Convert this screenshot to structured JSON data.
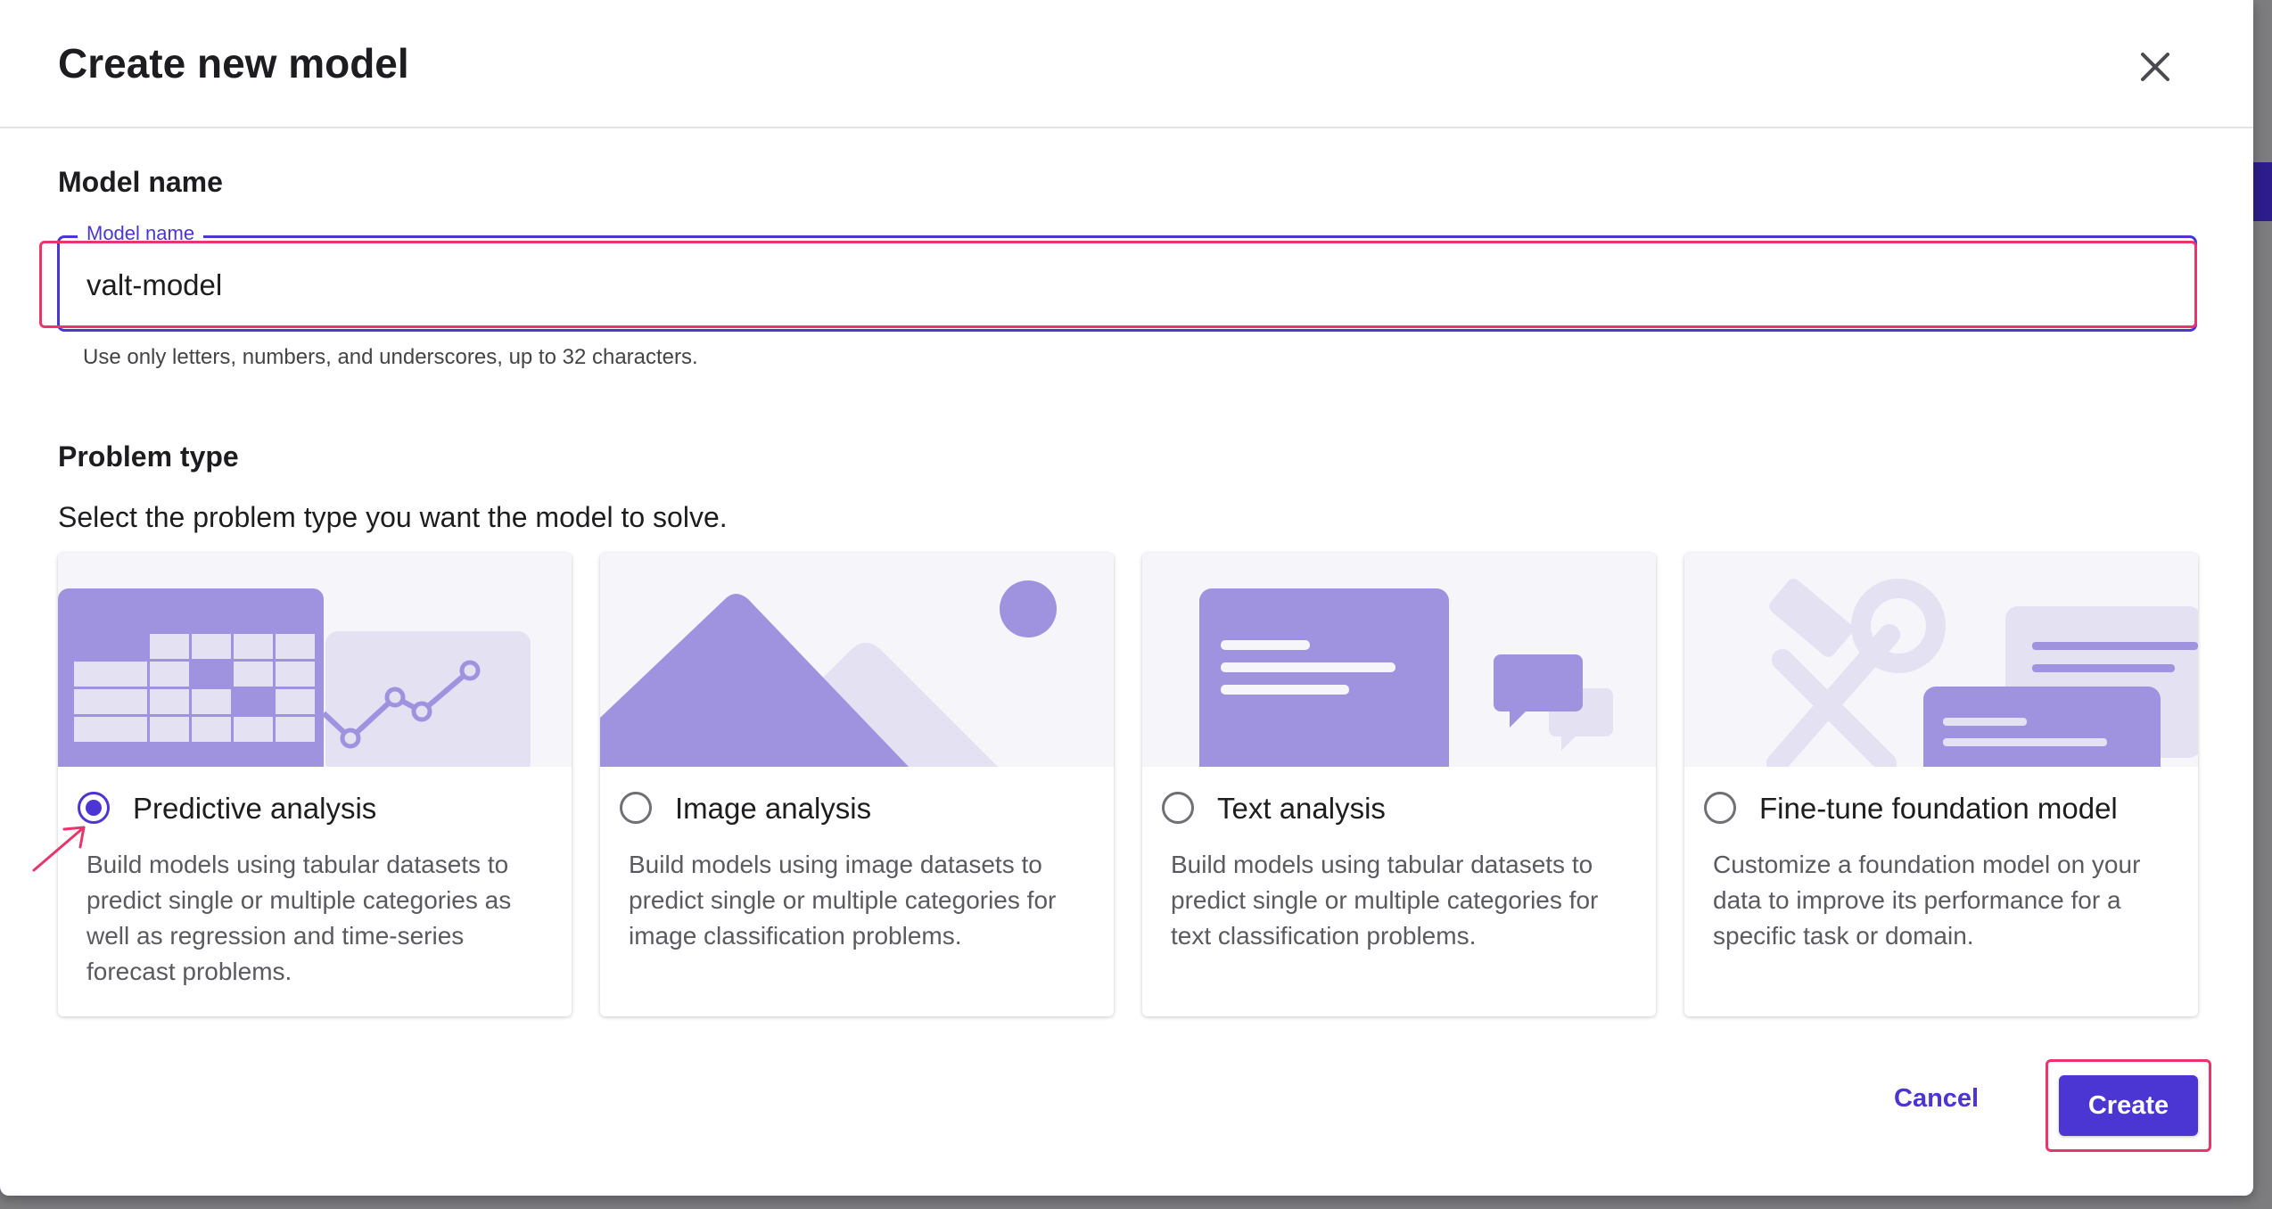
{
  "modal": {
    "title": "Create new model"
  },
  "model_name": {
    "section_title": "Model name",
    "legend": "Model name",
    "value": "valt-model",
    "helper": "Use only letters, numbers, and underscores, up to 32 characters."
  },
  "problem_type": {
    "section_title": "Problem type",
    "subtitle": "Select the problem type you want the model to solve.",
    "cards": [
      {
        "label": "Predictive analysis",
        "description": "Build models using tabular datasets to predict single or multiple categories as well as regression and time-series forecast problems.",
        "selected": true
      },
      {
        "label": "Image analysis",
        "description": "Build models using image datasets to predict single or multiple categories for image classification problems.",
        "selected": false
      },
      {
        "label": "Text analysis",
        "description": "Build models using tabular datasets to predict single or multiple categories for text classification problems.",
        "selected": false
      },
      {
        "label": "Fine-tune foundation model",
        "description": "Customize a foundation model on your data to improve its performance for a specific task or domain.",
        "selected": false
      }
    ]
  },
  "footer": {
    "cancel_label": "Cancel",
    "create_label": "Create"
  },
  "colors": {
    "accent": "#4c36d3",
    "illustration": "#9f93e0",
    "annotation": "#e8356e"
  }
}
